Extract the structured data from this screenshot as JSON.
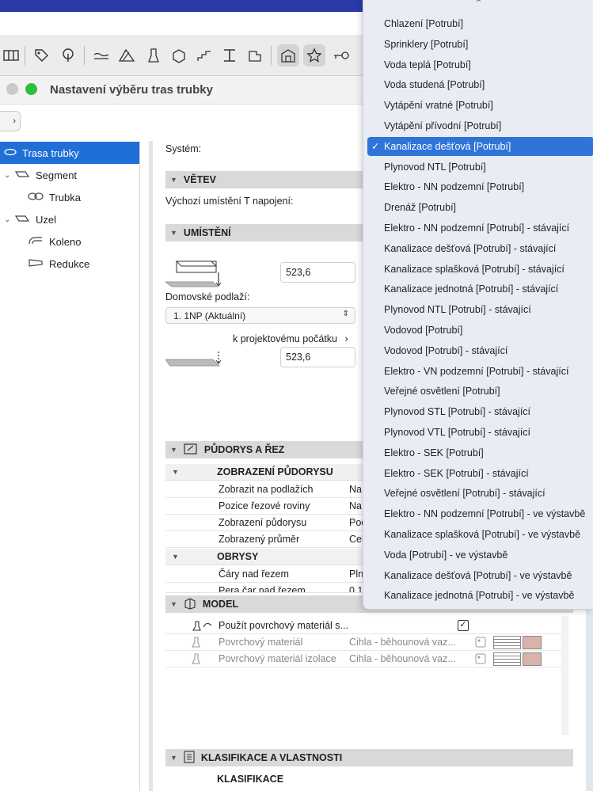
{
  "dialog": {
    "title": "Nastavení výběru tras trubky"
  },
  "tree": {
    "items": [
      {
        "label": "Trasa trubky",
        "level": 0,
        "selected": true
      },
      {
        "label": "Segment",
        "level": 0,
        "expanded": true
      },
      {
        "label": "Trubka",
        "level": 1
      },
      {
        "label": "Uzel",
        "level": 0,
        "expanded": true
      },
      {
        "label": "Koleno",
        "level": 1
      },
      {
        "label": "Redukce",
        "level": 1
      }
    ]
  },
  "main": {
    "system_label": "Systém:",
    "sections": {
      "vetev": "VĚTEV",
      "umisteni": "UMÍSTĚNÍ",
      "pudorys": "PŮDORYS A ŘEZ",
      "model": "MODEL",
      "klasifikace": "KLASIFIKACE A VLASTNOSTI"
    },
    "default_t_label": "Výchozí umístění T napojení:",
    "offset_value_1": "523,6",
    "home_floor_label": "Domovské podlaží:",
    "home_floor_value": "1. 1NP (Aktuální)",
    "origin_label": "k projektovému počátku",
    "offset_value_2": "523,6",
    "zobrazeni_pudorysu_head": "ZOBRAZENÍ PŮDORYSU",
    "plan_rows": [
      {
        "key": "Zobrazit na podlažích",
        "value": "Na"
      },
      {
        "key": "Pozice řezové roviny",
        "value": "Na"
      },
      {
        "key": "Zobrazení půdorysu",
        "value": "Poc"
      },
      {
        "key": "Zobrazený průměr",
        "value": "Cel"
      }
    ],
    "obrysy_head": "OBRYSY",
    "obrysy_rows": [
      {
        "key": "Čáry nad řezem",
        "value": "Pln"
      },
      {
        "key": "Pera čar nad řezem",
        "value": "0,1"
      }
    ],
    "model_rows": [
      {
        "key": "Použít povrchový materiál s...",
        "checked": true
      },
      {
        "key": "Povrchový materiál",
        "value": "Cihla - běhounová vaz..."
      },
      {
        "key": "Povrchový materiál izolace",
        "value": "Cihla - běhounová vaz..."
      }
    ],
    "klasifikace_head": "KLASIFIKACE"
  },
  "dropdown": {
    "items": [
      "Chlazení [Potrubí]",
      "Sprinklery [Potrubí]",
      "Voda teplá [Potrubí]",
      "Voda studená [Potrubí]",
      "Vytápění vratné [Potrubí]",
      "Vytápění přívodní [Potrubí]",
      "Kanalizace dešťová [Potrubí]",
      "Plynovod NTL [Potrubí]",
      "Elektro - NN podzemní [Potrubí]",
      "Drenáž [Potrubí]",
      "Elektro - NN podzemní [Potrubí] - stávající",
      "Kanalizace dešťová [Potrubí] - stávající",
      "Kanalizace splašková [Potrubí] - stávající",
      "Kanalizace jednotná [Potrubí] - stávající",
      "Plynovod NTL [Potrubí] - stávající",
      "Vodovod [Potrubí]",
      "Vodovod [Potrubí] - stávající",
      "Elektro - VN podzemní [Potrubí] - stávající",
      "Veřejné osvětlení [Potrubí]",
      "Plynovod STL [Potrubí] - stávající",
      "Plynovod VTL [Potrubí] - stávající",
      "Elektro - SEK [Potrubí]",
      "Elektro - SEK [Potrubí] - stávající",
      "Veřejné osvětlení [Potrubí] - stávající",
      "Elektro - NN podzemní [Potrubí] - ve výstavbě",
      "Kanalizace splašková [Potrubí] - ve výstavbě",
      "Voda [Potrubí] - ve výstavbě",
      "Kanalizace dešťová [Potrubí] - ve výstavbě",
      "Kanalizace jednotná [Potrubí] - ve výstavbě"
    ],
    "selected_index": 6
  },
  "colors": {
    "accent": "#1f6fd6",
    "menu_selection": "#2f74d8",
    "top_bar": "#2a3aa8"
  }
}
